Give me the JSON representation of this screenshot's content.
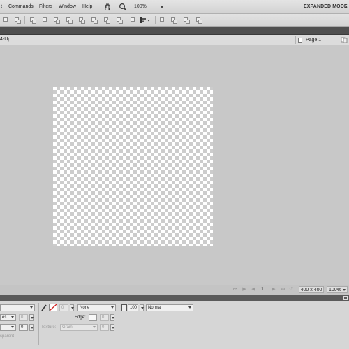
{
  "menubar": {
    "menus": [
      {
        "label": "t"
      },
      {
        "label": "Commands"
      },
      {
        "label": "Filters"
      },
      {
        "label": "Window"
      },
      {
        "label": "Help"
      }
    ],
    "hand_icon": "hand-icon",
    "zoom_icon": "magnifier-icon",
    "zoom_value": "100%",
    "mode": "EXPANDED MODE"
  },
  "toolbar": {
    "icons": [
      "new-icon",
      "save-icon",
      "paste-icon",
      "align-icon",
      "distribute-icon",
      "group-icon",
      "ungroup-icon",
      "join-icon",
      "split-icon",
      "union-icon",
      "intersect-icon",
      "rotate-icon",
      "flip-icon",
      "align-menu-icon",
      "arrange-icon",
      "front-icon",
      "back-icon",
      "layer-icon"
    ]
  },
  "docbar": {
    "view_label": "4-Up",
    "page_label": "Page 1"
  },
  "statusbar": {
    "page_number": "1",
    "doc_size": "400 x 400",
    "zoom": "100%"
  },
  "properties": {
    "row1": {
      "stroke_size": "0",
      "stroke_type": "None",
      "opacity": "100",
      "blend_mode": "Normal"
    },
    "row2": {
      "font_value": "es",
      "tracking": "0",
      "edge_label": "Edge:",
      "edge_value": "0"
    },
    "row3": {
      "leading": "0",
      "texture_label": "Texture:",
      "texture_value": "Grain",
      "texture_amount": "0"
    },
    "row4": {
      "transparent_label": "sparent"
    }
  },
  "colors": {
    "menubar_bg": "#dadada",
    "strip_bg": "#4f4f4f",
    "canvas_bg": "#c8c8c8",
    "stroke_none_red": "#d02020"
  }
}
